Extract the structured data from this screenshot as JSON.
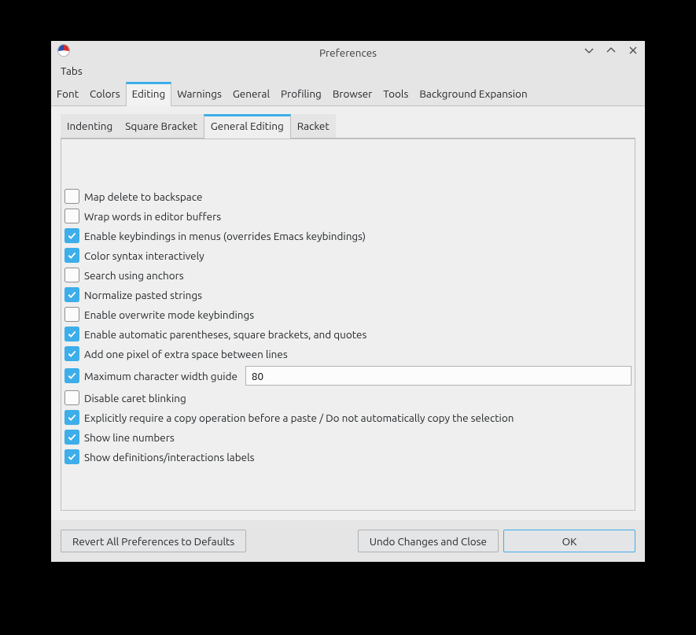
{
  "window": {
    "title": "Preferences"
  },
  "menubar": {
    "tabs_menu": "Tabs"
  },
  "mainTabs": [
    {
      "label": "Font"
    },
    {
      "label": "Colors"
    },
    {
      "label": "Editing",
      "active": true
    },
    {
      "label": "Warnings"
    },
    {
      "label": "General"
    },
    {
      "label": "Profiling"
    },
    {
      "label": "Browser"
    },
    {
      "label": "Tools"
    },
    {
      "label": "Background Expansion"
    }
  ],
  "subTabs": [
    {
      "label": "Indenting"
    },
    {
      "label": "Square Bracket"
    },
    {
      "label": "General Editing",
      "active": true
    },
    {
      "label": "Racket"
    }
  ],
  "options": [
    {
      "label": "Map delete to backspace",
      "checked": false
    },
    {
      "label": "Wrap words in editor buffers",
      "checked": false
    },
    {
      "label": "Enable keybindings in menus (overrides Emacs keybindings)",
      "checked": true
    },
    {
      "label": "Color syntax interactively",
      "checked": true
    },
    {
      "label": "Search using anchors",
      "checked": false
    },
    {
      "label": "Normalize pasted strings",
      "checked": true
    },
    {
      "label": "Enable overwrite mode keybindings",
      "checked": false
    },
    {
      "label": "Enable automatic parentheses, square brackets, and quotes",
      "checked": true
    },
    {
      "label": "Add one pixel of extra space between lines",
      "checked": true
    },
    {
      "label": "Maximum character width guide",
      "checked": true,
      "hasInput": true,
      "inputValue": "80"
    },
    {
      "label": "Disable caret blinking",
      "checked": false
    },
    {
      "label": "Explicitly require a copy operation before a paste / Do not automatically copy the selection",
      "checked": true
    },
    {
      "label": "Show line numbers",
      "checked": true
    },
    {
      "label": "Show definitions/interactions labels",
      "checked": true
    }
  ],
  "buttons": {
    "revert": "Revert All Preferences to Defaults",
    "undo": "Undo Changes and Close",
    "ok": "OK"
  }
}
